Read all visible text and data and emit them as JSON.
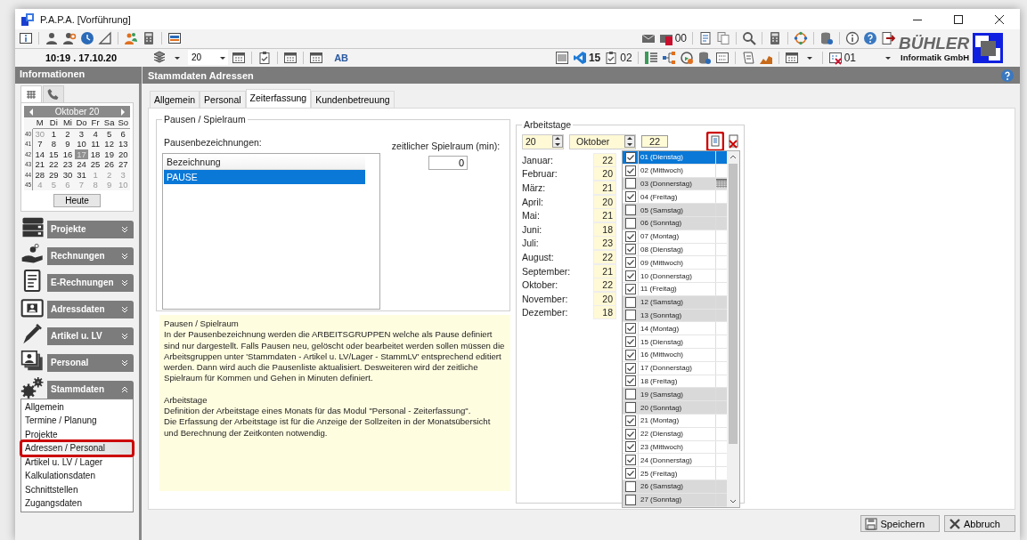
{
  "window": {
    "title": "P.A.P.A. [Vorführung]"
  },
  "toolbar": {
    "clock": "10:19 . 17.10.20",
    "year_combo": "20",
    "ab_label": "AB",
    "pdf_count": "00",
    "code_count": "15",
    "clipboard_count": "02",
    "calendar_count": "01"
  },
  "logo": {
    "name": "BÜHLER",
    "subtitle": "Informatik GmbH"
  },
  "left_header": "Informationen",
  "page_header": "Stammdaten Adressen",
  "calendar": {
    "month": "Oktober 20",
    "weekdays": [
      "M",
      "Di",
      "Mi",
      "Do",
      "Fr",
      "Sa",
      "So"
    ],
    "weeks": [
      {
        "week": "40",
        "days": [
          {
            "d": "30",
            "muted": true,
            "selected": false
          },
          {
            "d": "1",
            "muted": false,
            "selected": false
          },
          {
            "d": "2",
            "muted": false,
            "selected": false
          },
          {
            "d": "3",
            "muted": false,
            "selected": false
          },
          {
            "d": "4",
            "muted": false,
            "selected": false
          },
          {
            "d": "5",
            "muted": false,
            "selected": false
          },
          {
            "d": "6",
            "muted": false,
            "selected": false
          }
        ]
      },
      {
        "week": "41",
        "days": [
          {
            "d": "7",
            "muted": false,
            "selected": false
          },
          {
            "d": "8",
            "muted": false,
            "selected": false
          },
          {
            "d": "9",
            "muted": false,
            "selected": false
          },
          {
            "d": "10",
            "muted": false,
            "selected": false
          },
          {
            "d": "11",
            "muted": false,
            "selected": false
          },
          {
            "d": "12",
            "muted": false,
            "selected": false
          },
          {
            "d": "13",
            "muted": false,
            "selected": false
          }
        ]
      },
      {
        "week": "42",
        "days": [
          {
            "d": "14",
            "muted": false,
            "selected": false
          },
          {
            "d": "15",
            "muted": false,
            "selected": false
          },
          {
            "d": "16",
            "muted": false,
            "selected": false
          },
          {
            "d": "17",
            "muted": false,
            "selected": true
          },
          {
            "d": "18",
            "muted": false,
            "selected": false
          },
          {
            "d": "19",
            "muted": false,
            "selected": false
          },
          {
            "d": "20",
            "muted": false,
            "selected": false
          }
        ]
      },
      {
        "week": "43",
        "days": [
          {
            "d": "21",
            "muted": false,
            "selected": false
          },
          {
            "d": "22",
            "muted": false,
            "selected": false
          },
          {
            "d": "23",
            "muted": false,
            "selected": false
          },
          {
            "d": "24",
            "muted": false,
            "selected": false
          },
          {
            "d": "25",
            "muted": false,
            "selected": false
          },
          {
            "d": "26",
            "muted": false,
            "selected": false
          },
          {
            "d": "27",
            "muted": false,
            "selected": false
          }
        ]
      },
      {
        "week": "44",
        "days": [
          {
            "d": "28",
            "muted": false,
            "selected": false
          },
          {
            "d": "29",
            "muted": false,
            "selected": false
          },
          {
            "d": "30",
            "muted": false,
            "selected": false
          },
          {
            "d": "31",
            "muted": false,
            "selected": false
          },
          {
            "d": "1",
            "muted": true,
            "selected": false
          },
          {
            "d": "2",
            "muted": true,
            "selected": false
          },
          {
            "d": "3",
            "muted": true,
            "selected": false
          }
        ]
      },
      {
        "week": "45",
        "days": [
          {
            "d": "4",
            "muted": true,
            "selected": false
          },
          {
            "d": "5",
            "muted": true,
            "selected": false
          },
          {
            "d": "6",
            "muted": true,
            "selected": false
          },
          {
            "d": "7",
            "muted": true,
            "selected": false
          },
          {
            "d": "8",
            "muted": true,
            "selected": false
          },
          {
            "d": "9",
            "muted": true,
            "selected": false
          },
          {
            "d": "10",
            "muted": true,
            "selected": false
          }
        ]
      }
    ],
    "today_button": "Heute"
  },
  "sidebar": {
    "sections": [
      {
        "label": "Projekte",
        "kind": "server",
        "expanded": false
      },
      {
        "label": "Rechnungen",
        "kind": "coins",
        "expanded": false
      },
      {
        "label": "E-Rechnungen",
        "kind": "invoice",
        "expanded": false
      },
      {
        "label": "Adressdaten",
        "kind": "contact",
        "expanded": false
      },
      {
        "label": "Artikel u. LV",
        "kind": "pen",
        "expanded": false
      },
      {
        "label": "Personal",
        "kind": "photos",
        "expanded": false
      },
      {
        "label": "Stammdaten",
        "kind": "gears",
        "expanded": true,
        "items": [
          {
            "label": "Allgemein",
            "selected": false
          },
          {
            "label": "Termine / Planung",
            "selected": false
          },
          {
            "label": "Projekte",
            "selected": false
          },
          {
            "label": "Adressen / Personal",
            "selected": true
          },
          {
            "label": "Artikel u. LV / Lager",
            "selected": false
          },
          {
            "label": "Kalkulationsdaten",
            "selected": false
          },
          {
            "label": "Schnittstellen",
            "selected": false
          },
          {
            "label": "Zugangsdaten",
            "selected": false
          }
        ]
      }
    ]
  },
  "tabs": [
    {
      "label": "Allgemein",
      "selected": false
    },
    {
      "label": "Personal",
      "selected": false
    },
    {
      "label": "Zeiterfassung",
      "selected": true
    },
    {
      "label": "Kundenbetreuung",
      "selected": false
    }
  ],
  "pausen": {
    "legend": "Pausen / Spielraum",
    "list_label": "Pausenbezeichnungen:",
    "column": "Bezeichnung",
    "rows": [
      {
        "text": "PAUSE",
        "selected": true
      }
    ],
    "spielraum_label": "zeitlicher Spielraum (min):",
    "spielraum_value": "0"
  },
  "help": [
    {
      "title": "Pausen / Spielraum",
      "lines": [
        "In der Pausenbezeichnung werden die ARBEITSGRUPPEN welche als Pause definiert sind nur dargestellt. Falls Pausen neu, gelöscht oder bearbeitet werden sollen müssen die Arbeitsgruppen unter 'Stammdaten - Artikel u. LV/Lager - StammLV' entsprechend editiert werden. Dann wird auch die Pausenliste aktualisiert. Desweiteren wird der zeitliche Spielraum für Kommen und Gehen in Minuten definiert."
      ]
    },
    {
      "title": "Arbeitstage",
      "lines": [
        "Definition der Arbeitstage eines Monats für das Modul \"Personal - Zeiterfassung\".",
        "Die Erfassung der Arbeitstage ist für die Anzeige der Sollzeiten in der Monatsübersicht und  Berechnung der Zeitkonten notwendig."
      ]
    }
  ],
  "arbeitstage": {
    "legend": "Arbeitstage",
    "year": "20",
    "month": "Oktober",
    "count": "22",
    "months": [
      {
        "name": "Januar:",
        "days": "22"
      },
      {
        "name": "Februar:",
        "days": "20"
      },
      {
        "name": "März:",
        "days": "21"
      },
      {
        "name": "April:",
        "days": "20"
      },
      {
        "name": "Mai:",
        "days": "21"
      },
      {
        "name": "Juni:",
        "days": "18"
      },
      {
        "name": "Juli:",
        "days": "23"
      },
      {
        "name": "August:",
        "days": "22"
      },
      {
        "name": "September:",
        "days": "21"
      },
      {
        "name": "Oktober:",
        "days": "22"
      },
      {
        "name": "November:",
        "days": "20"
      },
      {
        "name": "Dezember:",
        "days": "18"
      }
    ],
    "days": [
      {
        "label": "01 (Dienstag)",
        "checked": true,
        "off": false,
        "holiday": false,
        "selected": true
      },
      {
        "label": "02 (Mittwoch)",
        "checked": true,
        "off": false,
        "holiday": false,
        "selected": false
      },
      {
        "label": "03 (Donnerstag)",
        "checked": false,
        "off": true,
        "holiday": true,
        "selected": false
      },
      {
        "label": "04 (Freitag)",
        "checked": true,
        "off": false,
        "holiday": false,
        "selected": false
      },
      {
        "label": "05 (Samstag)",
        "checked": false,
        "off": true,
        "holiday": false,
        "selected": false
      },
      {
        "label": "06 (Sonntag)",
        "checked": false,
        "off": true,
        "holiday": false,
        "selected": false
      },
      {
        "label": "07 (Montag)",
        "checked": true,
        "off": false,
        "holiday": false,
        "selected": false
      },
      {
        "label": "08 (Dienstag)",
        "checked": true,
        "off": false,
        "holiday": false,
        "selected": false
      },
      {
        "label": "09 (Mittwoch)",
        "checked": true,
        "off": false,
        "holiday": false,
        "selected": false
      },
      {
        "label": "10 (Donnerstag)",
        "checked": true,
        "off": false,
        "holiday": false,
        "selected": false
      },
      {
        "label": "11 (Freitag)",
        "checked": true,
        "off": false,
        "holiday": false,
        "selected": false
      },
      {
        "label": "12 (Samstag)",
        "checked": false,
        "off": true,
        "holiday": false,
        "selected": false
      },
      {
        "label": "13 (Sonntag)",
        "checked": false,
        "off": true,
        "holiday": false,
        "selected": false
      },
      {
        "label": "14 (Montag)",
        "checked": true,
        "off": false,
        "holiday": false,
        "selected": false
      },
      {
        "label": "15 (Dienstag)",
        "checked": true,
        "off": false,
        "holiday": false,
        "selected": false
      },
      {
        "label": "16 (Mittwoch)",
        "checked": true,
        "off": false,
        "holiday": false,
        "selected": false
      },
      {
        "label": "17 (Donnerstag)",
        "checked": true,
        "off": false,
        "holiday": false,
        "selected": false
      },
      {
        "label": "18 (Freitag)",
        "checked": true,
        "off": false,
        "holiday": false,
        "selected": false
      },
      {
        "label": "19 (Samstag)",
        "checked": false,
        "off": true,
        "holiday": false,
        "selected": false
      },
      {
        "label": "20 (Sonntag)",
        "checked": false,
        "off": true,
        "holiday": false,
        "selected": false
      },
      {
        "label": "21 (Montag)",
        "checked": true,
        "off": false,
        "holiday": false,
        "selected": false
      },
      {
        "label": "22 (Dienstag)",
        "checked": true,
        "off": false,
        "holiday": false,
        "selected": false
      },
      {
        "label": "23 (Mittwoch)",
        "checked": true,
        "off": false,
        "holiday": false,
        "selected": false
      },
      {
        "label": "24 (Donnerstag)",
        "checked": true,
        "off": false,
        "holiday": false,
        "selected": false
      },
      {
        "label": "25 (Freitag)",
        "checked": true,
        "off": false,
        "holiday": false,
        "selected": false
      },
      {
        "label": "26 (Samstag)",
        "checked": false,
        "off": true,
        "holiday": false,
        "selected": false
      },
      {
        "label": "27 (Sonntag)",
        "checked": false,
        "off": true,
        "holiday": false,
        "selected": false
      }
    ]
  },
  "buttons": [
    {
      "label": "Speichern",
      "kind": "save"
    },
    {
      "label": "Abbruch",
      "kind": "cancel"
    }
  ]
}
